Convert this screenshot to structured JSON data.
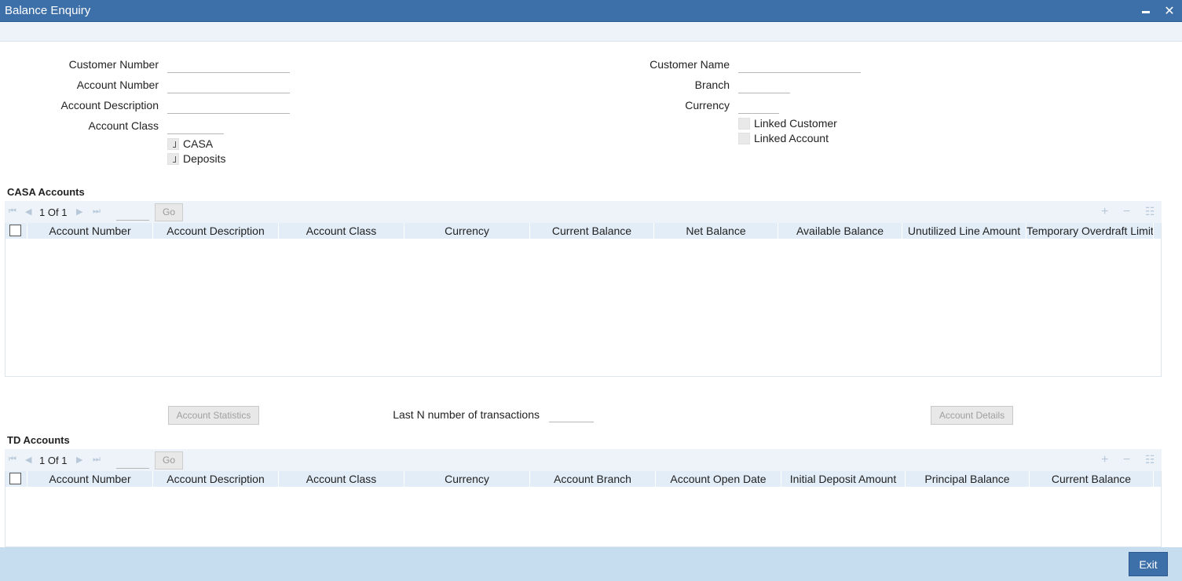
{
  "window": {
    "title": "Balance Enquiry",
    "minimize_glyph": "▬",
    "close_glyph": "✕"
  },
  "form": {
    "customer_number": {
      "label": "Customer Number",
      "value": ""
    },
    "account_number": {
      "label": "Account Number",
      "value": ""
    },
    "account_description": {
      "label": "Account Description",
      "value": ""
    },
    "account_class": {
      "label": "Account Class",
      "value": ""
    },
    "casa": {
      "label": "CASA",
      "checked": true
    },
    "deposits": {
      "label": "Deposits",
      "checked": true
    },
    "customer_name": {
      "label": "Customer Name",
      "value": ""
    },
    "branch": {
      "label": "Branch",
      "value": ""
    },
    "currency": {
      "label": "Currency",
      "value": ""
    },
    "linked_customer": {
      "label": "Linked Customer",
      "checked": false
    },
    "linked_account": {
      "label": "Linked Account",
      "checked": false
    }
  },
  "casa_section": {
    "title": "CASA Accounts",
    "pager": {
      "current": "1",
      "of_label": "Of",
      "total": "1",
      "go_label": "Go"
    },
    "columns": [
      "Account Number",
      "Account Description",
      "Account Class",
      "Currency",
      "Current Balance",
      "Net Balance",
      "Available Balance",
      "Unutilized Line Amount",
      "Temporary Overdraft Limit"
    ],
    "rows": []
  },
  "actions": {
    "account_statistics": "Account Statistics",
    "last_n_label": "Last N number of transactions",
    "last_n_value": "",
    "account_details": "Account Details"
  },
  "td_section": {
    "title": "TD Accounts",
    "pager": {
      "current": "1",
      "of_label": "Of",
      "total": "1",
      "go_label": "Go"
    },
    "columns": [
      "Account Number",
      "Account Description",
      "Account Class",
      "Currency",
      "Account Branch",
      "Account Open Date",
      "Initial Deposit Amount",
      "Principal Balance",
      "Current Balance"
    ],
    "rows": []
  },
  "footer": {
    "exit_label": "Exit"
  },
  "colors": {
    "titlebar": "#3d6fa8",
    "header_row": "#e3edf7",
    "footer": "#c6dcef"
  }
}
